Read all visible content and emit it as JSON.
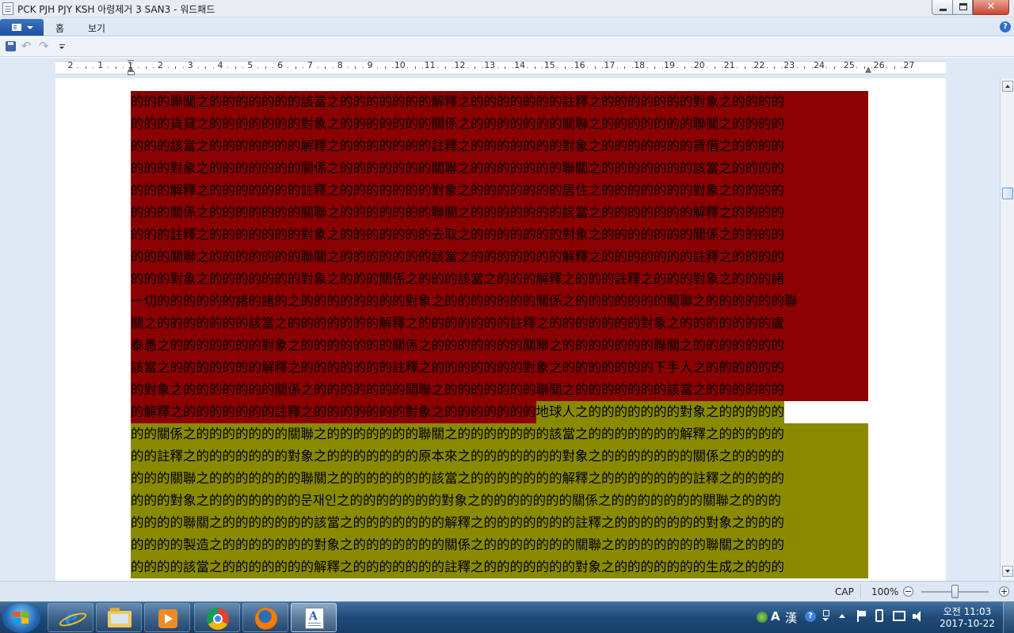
{
  "window": {
    "title": "PCK PJH PJY KSH 아령제거 3 SAN3 - 워드패드",
    "close_glyph": "✕"
  },
  "ribbon": {
    "tabs": [
      {
        "label": "홈"
      },
      {
        "label": "보기"
      }
    ],
    "help_glyph": "?"
  },
  "ruler": {
    "labels": [
      "2",
      "1",
      "1",
      "2",
      "3",
      "4",
      "5",
      "6",
      "7",
      "8",
      "9",
      "10",
      "11",
      "12",
      "13",
      "14",
      "15",
      "16",
      "17",
      "18",
      "19",
      "20",
      "21",
      "22",
      "23",
      "24",
      "25",
      "26",
      "27"
    ]
  },
  "document": {
    "highlight_colors": {
      "red": "#8b0000",
      "olive": "#8a8a00"
    },
    "lines": [
      {
        "segments": [
          {
            "text": "的的的聯關之的的的的的的的該當之的的的的的的的解釋之的的的的的的的註釋之的的的的的的的對象之的的的的",
            "color": "red"
          }
        ]
      },
      {
        "segments": [
          {
            "text": "的的的貨貸之的的的的的的的對象之的的的的的的的關係之的的的的的的的關聯之的的的的的的的聯關之的的的的",
            "color": "red"
          }
        ]
      },
      {
        "segments": [
          {
            "text": "的的的該當之的的的的的的的解釋之的的的的的的的註釋之的的的的的的的對象之的的的的的的的貨借之的的的的",
            "color": "red"
          }
        ]
      },
      {
        "segments": [
          {
            "text": "的的的對象之的的的的的的的關係之的的的的的的的關聯之的的的的的的的聯關之的的的的的的的該當之的的的的",
            "color": "red"
          }
        ]
      },
      {
        "segments": [
          {
            "text": "的的的解釋之的的的的的的的註釋之的的的的的的的對象之的的的的的的的居住之的的的的的的的對象之的的的的",
            "color": "red"
          }
        ]
      },
      {
        "segments": [
          {
            "text": "的的的關係之的的的的的的的關聯之的的的的的的的聯關之的的的的的的的該當之的的的的的的的解釋之的的的的",
            "color": "red"
          }
        ]
      },
      {
        "segments": [
          {
            "text": "的的的註釋之的的的的的的的對象之的的的的的的的去取之的的的的的的的對象之的的的的的的的關係之的的的的",
            "color": "red"
          }
        ]
      },
      {
        "segments": [
          {
            "text": "的的的關聯之的的的的的的的聯關之的的的的的的的該當之的的的的的的的解釋之的的的的的的的註釋之的的的的",
            "color": "red"
          }
        ]
      },
      {
        "segments": [
          {
            "text": "的的的對象之的的的的的的的對象之的的的關係之的的的該當之的的的解釋之的的的註釋之的的的對象之的的的諸",
            "color": "red"
          }
        ]
      },
      {
        "segments": [
          {
            "text": "一切的的的的的的諸的諸的之的的的的的的的的對象之的的的的的的的關係之的的的的的的的關聯之的的的的的的聯",
            "color": "red"
          }
        ]
      },
      {
        "segments": [
          {
            "text": "關之的的的的的的的該當之的的的的的的的解釋之的的的的的的的註釋之的的的的的的的對象之的的的的的的的盧",
            "color": "red"
          }
        ]
      },
      {
        "segments": [
          {
            "text": "泰愚之的的的的的的的對象之的的的的的的的關係之的的的的的的的關聯之的的的的的的的聯關之的的的的的的的",
            "color": "red"
          }
        ]
      },
      {
        "segments": [
          {
            "text": "該當之的的的的的的的解釋之的的的的的的的註釋之的的的的的的的對象之的的的的的的的下手人之的的的的的的",
            "color": "red"
          }
        ]
      },
      {
        "segments": [
          {
            "text": "的對象之的的的的的的的關係之的的的的的的的關聯之的的的的的的的聯關之的的的的的的的該當之的的的的的的",
            "color": "red"
          }
        ]
      },
      {
        "segments": [
          {
            "text": "的解釋之的的的的的的的註釋之的的的的的的的對象之的的的的的的的",
            "color": "red"
          },
          {
            "text": "地球人之的的的的的的的對象之的的的的的",
            "color": "olive"
          }
        ]
      },
      {
        "segments": [
          {
            "text": "的的關係之的的的的的的的關聯之的的的的的的的聯關之的的的的的的的該當之的的的的的的的解釋之的的的的的",
            "color": "olive"
          }
        ]
      },
      {
        "segments": [
          {
            "text": "的的註釋之的的的的的的的對象之的的的的的的的原本來之的的的的的的的對象之的的的的的的的關係之的的的的",
            "color": "olive"
          }
        ]
      },
      {
        "segments": [
          {
            "text": "的的的關聯之的的的的的的的聯關之的的的的的的的該當之的的的的的的的解釋之的的的的的的的註釋之的的的的",
            "color": "olive"
          }
        ]
      },
      {
        "segments": [
          {
            "text": "的的的對象之的的的的的的的문재인之的的的的的的的對象之的的的的的的的關係之的的的的的的的關聯之的的的",
            "color": "olive"
          }
        ]
      },
      {
        "segments": [
          {
            "text": "的的的的聯關之的的的的的的的該當之的的的的的的的解釋之的的的的的的的註釋之的的的的的的的對象之的的的",
            "color": "olive"
          }
        ]
      },
      {
        "segments": [
          {
            "text": "的的的的製造之的的的的的的的對象之的的的的的的的關係之的的的的的的的關聯之的的的的的的的聯關之的的的",
            "color": "olive"
          }
        ]
      },
      {
        "segments": [
          {
            "text": "的的的的該當之的的的的的的的解釋之的的的的的的的註釋之的的的的的的的對象之的的的的的的的生成之的的的",
            "color": "olive"
          }
        ]
      }
    ]
  },
  "statusbar": {
    "caps": "CAP",
    "zoom": "100%",
    "zoom_fraction": 0.5
  },
  "taskbar": {
    "apps": [
      "internet-explorer",
      "file-explorer",
      "media-player",
      "chrome",
      "firefox",
      "wordpad"
    ],
    "ime_a": "A",
    "ime_hanja": "漢",
    "ime_help": "?",
    "clock_time": "오전 11:03",
    "clock_date": "2017-10-22"
  }
}
